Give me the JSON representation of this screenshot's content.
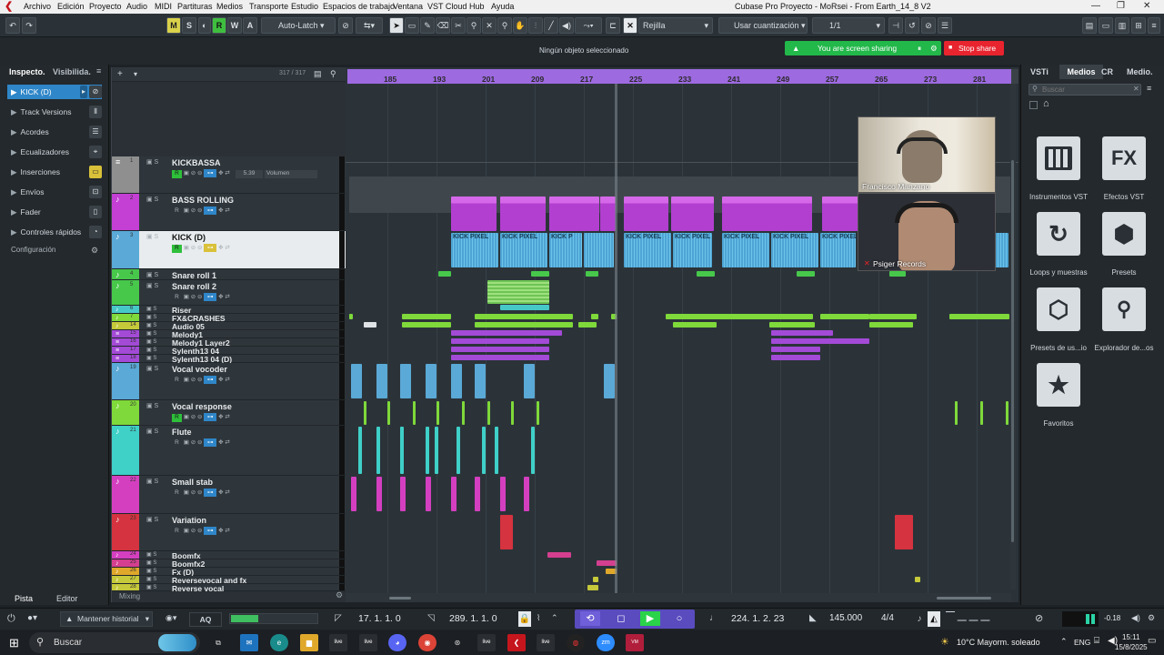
{
  "menubar": {
    "items": [
      "Archivo",
      "Edición",
      "Proyecto",
      "Audio",
      "MIDI",
      "Partituras",
      "Medios",
      "Transporte",
      "Estudio",
      "Espacios de trabajo",
      "Ventana",
      "VST Cloud",
      "Hub",
      "Ayuda"
    ],
    "title": "Cubase Pro Proyecto - MoRsei - From Earth_14_8 V2"
  },
  "toolbar": {
    "m": "M",
    "s": "S",
    "r": "R",
    "w": "W",
    "a": "A",
    "autolatch": "Auto-Latch",
    "grid": "Rejilla",
    "quant": "Usar cuantización",
    "quant_value": "1/1"
  },
  "status": {
    "no_selection": "Ningún objeto seleccionado",
    "sharing": "You are screen sharing",
    "stop_share": "Stop share"
  },
  "inspector": {
    "tab_inspector": "Inspecto.",
    "tab_visibility": "Visibilida.",
    "selected_track": "KICK (D)",
    "rows": [
      "Track Versions",
      "Acordes",
      "Ecualizadores",
      "Inserciones",
      "Envíos",
      "Fader",
      "Controles rápidos"
    ],
    "config": "Configuración",
    "bottom_tab_track": "Pista",
    "bottom_tab_editor": "Editor"
  },
  "tracklist": {
    "counter": "317 / 317",
    "mixing": "Mixing",
    "kickbassa_value": "5.39",
    "kickbassa_volume": "Volumen",
    "tracks": [
      {
        "num": "1",
        "name": "KICKBASSA"
      },
      {
        "num": "2",
        "name": "BASS ROLLING"
      },
      {
        "num": "3",
        "name": "KICK (D)"
      },
      {
        "num": "4",
        "name": "Snare roll 1"
      },
      {
        "num": "5",
        "name": "Snare roll 2"
      },
      {
        "num": "6",
        "name": "Riser"
      },
      {
        "num": "7",
        "name": "FX&CRASHES"
      },
      {
        "num": "14",
        "name": "Audio 05"
      },
      {
        "num": "15",
        "name": "Melody1"
      },
      {
        "num": "16",
        "name": "Melody1 Layer2"
      },
      {
        "num": "17",
        "name": "Sylenth13 04"
      },
      {
        "num": "18",
        "name": "Sylenth13 04 (D)"
      },
      {
        "num": "19",
        "name": "Vocal vocoder"
      },
      {
        "num": "20",
        "name": "Vocal response"
      },
      {
        "num": "21",
        "name": "Flute"
      },
      {
        "num": "22",
        "name": "Small stab"
      },
      {
        "num": "23",
        "name": "Variation"
      },
      {
        "num": "24",
        "name": "Boomfx"
      },
      {
        "num": "25",
        "name": "Boomfx2"
      },
      {
        "num": "26",
        "name": "Fx (D)"
      },
      {
        "num": "27",
        "name": "Reversevocal and fx"
      },
      {
        "num": "28",
        "name": "Reverse vocal"
      }
    ]
  },
  "ruler": {
    "bars": [
      "185",
      "193",
      "201",
      "209",
      "217",
      "225",
      "233",
      "241",
      "249",
      "257",
      "265",
      "273",
      "281"
    ]
  },
  "clips": {
    "kick_label": "KICK PIXEL",
    "kick_short": "KICK P"
  },
  "video": {
    "person1": "Francisco Manzano",
    "person2": "Psiger Records"
  },
  "rightpanel": {
    "tabs": [
      "VSTi",
      "Medios",
      "CR",
      "Medio."
    ],
    "search_placeholder": "Buscar",
    "tiles": [
      {
        "label": "Instrumentos VST",
        "icon": "piano-icon"
      },
      {
        "label": "Efectos VST",
        "icon": "fx-icon",
        "glyph": "FX"
      },
      {
        "label": "Loops y muestras",
        "icon": "loop-icon"
      },
      {
        "label": "Presets",
        "icon": "presets-icon"
      },
      {
        "label": "Presets de us...io",
        "icon": "user-presets-icon"
      },
      {
        "label": "Explorador de...os",
        "icon": "explorer-icon"
      },
      {
        "label": "Favoritos",
        "icon": "star-icon"
      }
    ]
  },
  "transport": {
    "history": "Mantener historial",
    "aq": "AQ",
    "left_locator": "17. 1. 1.   0",
    "right_locator": "289. 1. 1.   0",
    "position": "224. 1. 2. 23",
    "tempo": "145.000",
    "signature": "4/4",
    "level": "-0.18"
  },
  "taskbar": {
    "search": "Buscar",
    "weather": "10°C  Mayorm. soleado",
    "lang": "ENG",
    "time": "15:11",
    "date": "15/8/2025"
  }
}
